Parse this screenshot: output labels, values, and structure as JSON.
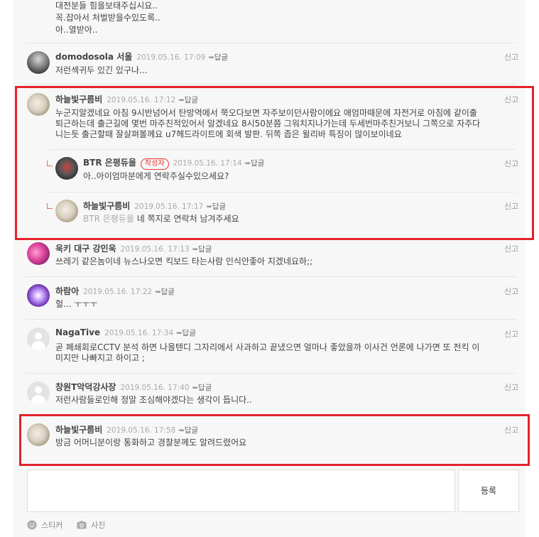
{
  "top_text_lines": [
    "대전분들 힘을보태주십시요..",
    "꼭.잡아서 처벌받을수있도록..",
    "아..열받아.."
  ],
  "comments": [
    {
      "name": "domodosola 서울",
      "date": "2019.05.16. 17:09",
      "reply": "답글",
      "report": "신고",
      "text": [
        "저런섹귀두 있긴 있구나..."
      ]
    },
    {
      "name": "하늘빛구름비",
      "date": "2019.05.16. 17:12",
      "reply": "답글",
      "report": "신고",
      "text": [
        "누군지알겠네요 아침 9시반넘어서 탄방역에서 쭉오다보면 자주보이던사람이에요 애엄마때문에 자전거로 아침에 같이출",
        "퇴근하는데 출근길에 몇번 마주친적있어서 알겠네요 8시50분쯤 그워치지나가는데 두세번마주친거보니 그쪽으로 자주다",
        "니는듯 출근할때 잘살펴볼께요 u7헤드라이트에 회색 발판. 뒤쪽 좁은 윌리바 특징이 많이보이네요"
      ]
    },
    {
      "name": "BTR 은평듀올",
      "badge": "작성자",
      "date": "2019.05.16. 17:14",
      "reply": "답글",
      "report": "신고",
      "text": [
        "아..아이엄마분에게 연락주실수있으세요?"
      ]
    },
    {
      "name": "하늘빛구름비",
      "date": "2019.05.16. 17:17",
      "reply": "답글",
      "report": "신고",
      "mention": "BTR 은평듀올",
      "text": [
        "네 쪽지로 연락처 남겨주세요"
      ]
    },
    {
      "name": "욱키 대구 강민욱",
      "date": "2019.05.16. 17:13",
      "reply": "답글",
      "report": "신고",
      "text": [
        "쓰레기 같은놈이네 뉴스나오면 킥보드 타는사람 인식안좋아 지겠네요하;;"
      ]
    },
    {
      "name": "하람아",
      "date": "2019.05.16. 17:22",
      "reply": "답글",
      "report": "신고",
      "text": [
        "헐... ㅜㅜㅜ"
      ]
    },
    {
      "name": "NagaTive",
      "date": "2019.05.16. 17:34",
      "reply": "답글",
      "report": "신고",
      "text": [
        "곧 폐쇄회로CCTV 분석 하면 나올텐디 그자리에서 사과하고 끝냈으면 얼마나 좋았을까 이사건 언론에 나가면 또 전킥 이",
        "미지만 나빠지고 하이고 ;"
      ]
    },
    {
      "name": "창원T악덕강사장",
      "date": "2019.05.16. 17:40",
      "reply": "답글",
      "report": "신고",
      "text": [
        "저런사람들로인해 정말 조심해야겠다는 생각이 듭니다.."
      ]
    },
    {
      "name": "하늘빛구름비",
      "date": "2019.05.16. 17:58",
      "reply": "답글",
      "report": "신고",
      "text": [
        "방금 어머니분이랑 통화하고 경찰분께도 알려드렸어요"
      ]
    }
  ],
  "composer": {
    "submit_label": "등록",
    "sticker_label": "스티커",
    "photo_label": "사진"
  },
  "colors": {
    "highlight": "#e3232c",
    "author_badge": "#e33333"
  }
}
